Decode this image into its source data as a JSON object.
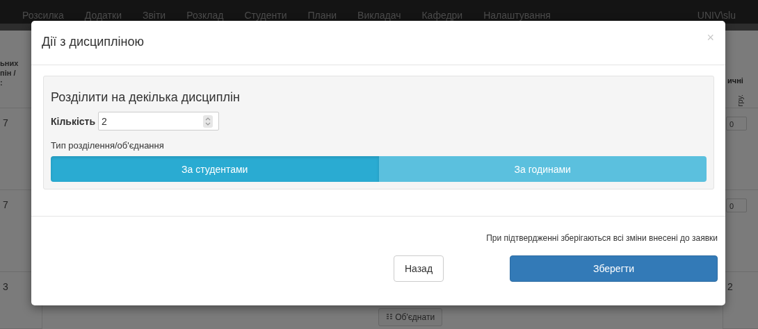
{
  "navbar": {
    "items": [
      "Розсилка",
      "Додатки",
      "Звіти",
      "Розклад",
      "Студенти",
      "Плани",
      "Викладач",
      "Кафедри",
      "Налаштування"
    ],
    "user": "UNIV\\slu"
  },
  "background_table": {
    "left_header": [
      "ьних",
      "пін /",
      ":"
    ],
    "left_cells": [
      "7",
      "7",
      "3"
    ],
    "right_header": "ичні",
    "right_subheader": "гру.",
    "right_cells": [
      {
        "kind": "input",
        "value": "0"
      },
      {
        "kind": "input",
        "value": "0"
      },
      {
        "kind": "text",
        "value": "2"
      }
    ],
    "merge_button": "Об'єднати"
  },
  "modal": {
    "title": "Дії з дисципліною",
    "close": "×",
    "section_title": "Розділити на декілька дисциплін",
    "count_label": "Кількість",
    "count_value": "2",
    "type_label": "Тип розділення/об'єднання",
    "options": [
      {
        "label": "За студентами",
        "selected": true
      },
      {
        "label": "За годинами",
        "selected": false
      }
    ],
    "note": "При підтвердженні зберігаються всі зміни внесені до заявки",
    "back_button": "Назад",
    "save_button": "Зберегти"
  }
}
